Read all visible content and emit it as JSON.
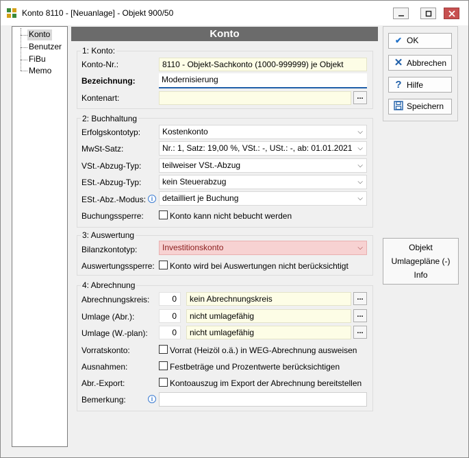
{
  "window": {
    "title": "Konto 8110 - [Neuanlage] - Objekt 900/50"
  },
  "tree": {
    "items": [
      "Konto",
      "Benutzer",
      "FiBu",
      "Memo"
    ]
  },
  "header": {
    "title": "Konto"
  },
  "g1": {
    "title": "1: Konto:",
    "konto_label": "Konto-Nr.:",
    "konto_value": "8110 - Objekt-Sachkonto (1000-999999) je Objekt",
    "bez_label": "Bezeichnung:",
    "bez_value": "Modernisierung",
    "art_label": "Kontenart:",
    "art_value": "",
    "dots": "..."
  },
  "g2": {
    "title": "2: Buchhaltung",
    "rows": [
      {
        "label": "Erfolgskontotyp:",
        "value": "Kostenkonto"
      },
      {
        "label": "MwSt-Satz:",
        "value": "Nr.: 1,  Satz: 19,00 %,  VSt.: -,  USt.: -,  ab: 01.01.2021"
      },
      {
        "label": "VSt.-Abzug-Typ:",
        "value": "teilweiser VSt.-Abzug"
      },
      {
        "label": "ESt.-Abzug-Typ:",
        "value": "kein Steuerabzug"
      },
      {
        "label": "ESt.-Abz.-Modus:",
        "value": "detailliert je Buchung"
      }
    ],
    "sperre_label": "Buchungssperre:",
    "sperre_chk": "Konto kann nicht bebucht werden"
  },
  "g3": {
    "title": "3: Auswertung",
    "bilanz_label": "Bilanzkontotyp:",
    "bilanz_value": "Investitionskonto",
    "sperre_label": "Auswertungssperre:",
    "sperre_chk": "Konto wird bei Auswertungen nicht berücksichtigt"
  },
  "g4": {
    "title": "4: Abrechnung",
    "rows": [
      {
        "label": "Abrechnungskreis:",
        "num": "0",
        "value": "kein Abrechnungskreis"
      },
      {
        "label": "Umlage (Abr.):",
        "num": "0",
        "value": "nicht umlagefähig"
      },
      {
        "label": "Umlage (W.-plan):",
        "num": "0",
        "value": "nicht umlagefähig"
      }
    ],
    "checks": [
      {
        "label": "Vorratskonto:",
        "chk": "Vorrat (Heizöl o.ä.) in WEG-Abrechnung ausweisen"
      },
      {
        "label": "Ausnahmen:",
        "chk": "Festbeträge und Prozentwerte berücksichtigen"
      },
      {
        "label": "Abr.-Export:",
        "chk": "Kontoauszug im Export der Abrechnung bereitstellen"
      }
    ],
    "bem_label": "Bemerkung:",
    "bem_value": ""
  },
  "buttons": {
    "ok": "OK",
    "cancel": "Abbrechen",
    "help": "Hilfe",
    "save": "Speichern"
  },
  "side": {
    "line1": "Objekt",
    "line2": "Umlagepläne (-)",
    "line3": "Info"
  },
  "icons": {
    "info": "i",
    "arrow": "⌵"
  }
}
